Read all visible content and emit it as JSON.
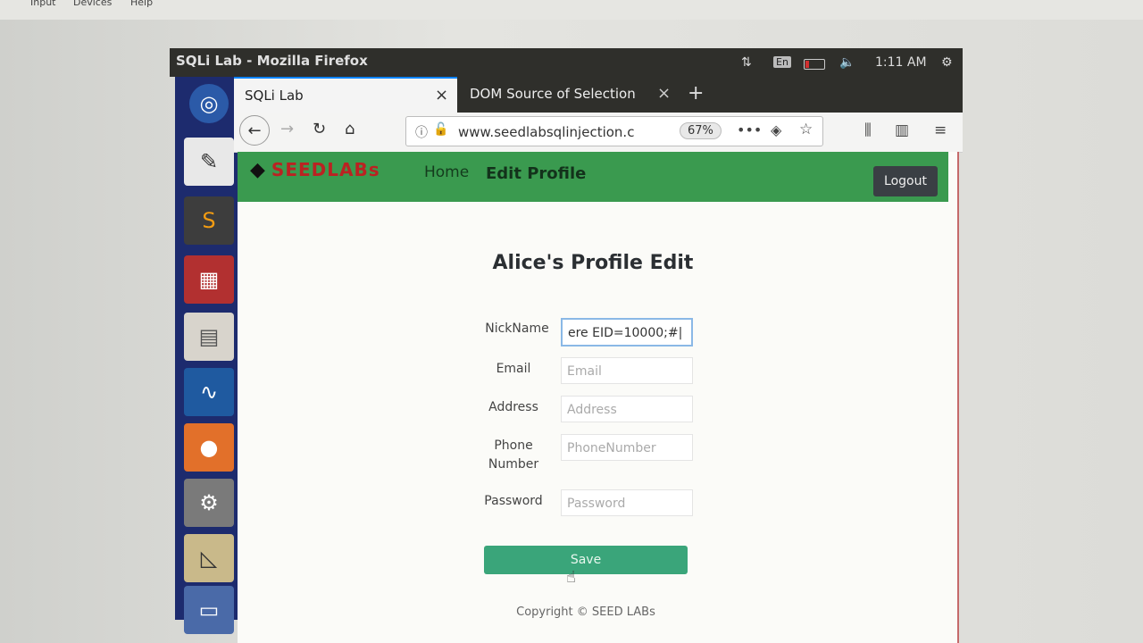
{
  "host_menu": {
    "items": [
      "Input",
      "Devices",
      "Help"
    ]
  },
  "top_panel": {
    "window_title": "SQLi Lab - Mozilla Firefox",
    "language": "En",
    "clock": "1:11 AM"
  },
  "browser": {
    "tabs": [
      {
        "label": "SQLi Lab",
        "close": "×"
      },
      {
        "label": "DOM Source of Selection",
        "close": "×"
      }
    ],
    "new_tab": "+",
    "url": "www.seedlabsqlinjection.c",
    "zoom": "67%"
  },
  "site": {
    "logo_text": "SEEDLABs",
    "nav": {
      "home": "Home",
      "edit_profile": "Edit Profile"
    },
    "logout": "Logout"
  },
  "page": {
    "heading": "Alice's Profile Edit",
    "form": {
      "nickname": {
        "label": "NickName",
        "value": "ere EID=10000;#|"
      },
      "email": {
        "label": "Email",
        "placeholder": "Email"
      },
      "address": {
        "label": "Address",
        "placeholder": "Address"
      },
      "phone": {
        "label_line1": "Phone",
        "label_line2": "Number",
        "placeholder": "PhoneNumber"
      },
      "password": {
        "label": "Password",
        "placeholder": "Password"
      }
    },
    "save": "Save",
    "copyright": "Copyright © SEED LABs"
  }
}
